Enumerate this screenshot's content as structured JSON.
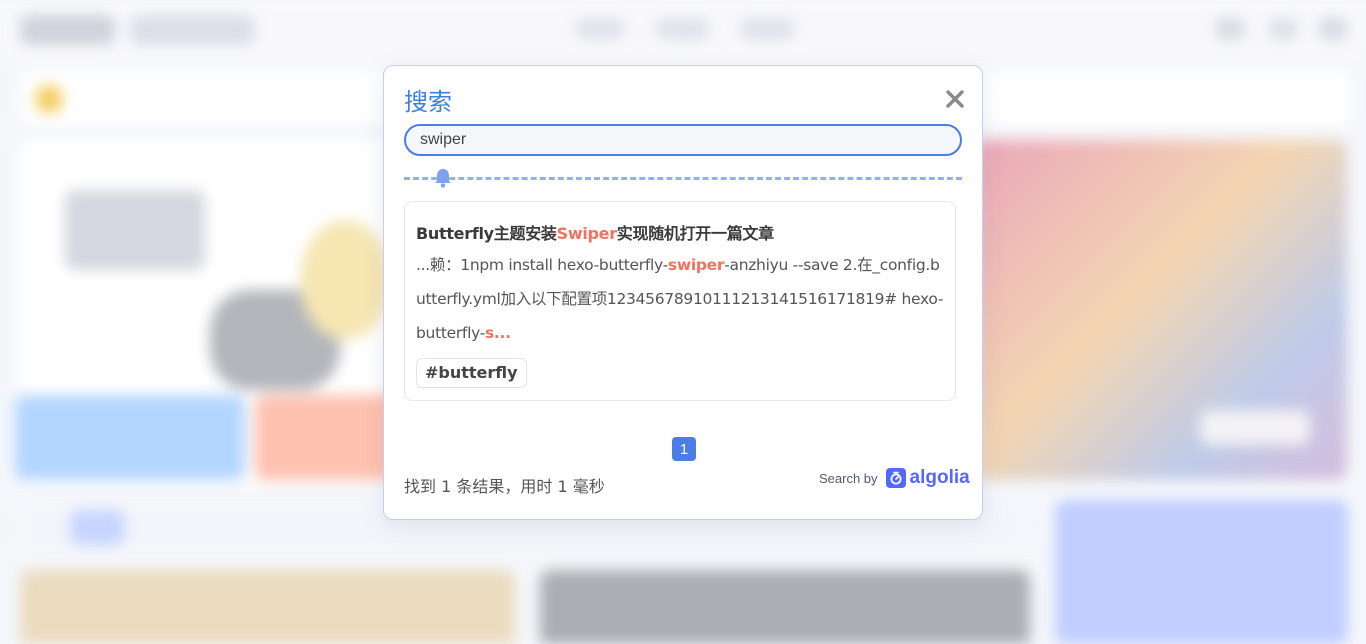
{
  "dialog": {
    "title": "搜索",
    "close_icon": "close-icon",
    "search_value": "swiper",
    "search_placeholder": "",
    "divider_icon": "bell-icon"
  },
  "result": {
    "title_prefix": "Butterfly主题安装",
    "title_match": "Swiper",
    "title_suffix": "实现随机打开一篇文章",
    "snippet_prefix": "...赖：1npm install hexo-butterfly-",
    "snippet_match1": "swiper",
    "snippet_middle": "-anzhiyu --save 2.在_config.butterfly.yml加入以下配置项12345678910111213141516171819# hexo-butterfly-",
    "snippet_match2": "s...",
    "tag": "#butterfly"
  },
  "pagination": {
    "current_page": "1"
  },
  "footer": {
    "stats": "找到 1 条结果，用时 1 毫秒",
    "search_by": "Search by",
    "brand": "algolia"
  },
  "colors": {
    "accent": "#4a7de6",
    "highlight": "#f07360",
    "algolia": "#5468ff"
  }
}
